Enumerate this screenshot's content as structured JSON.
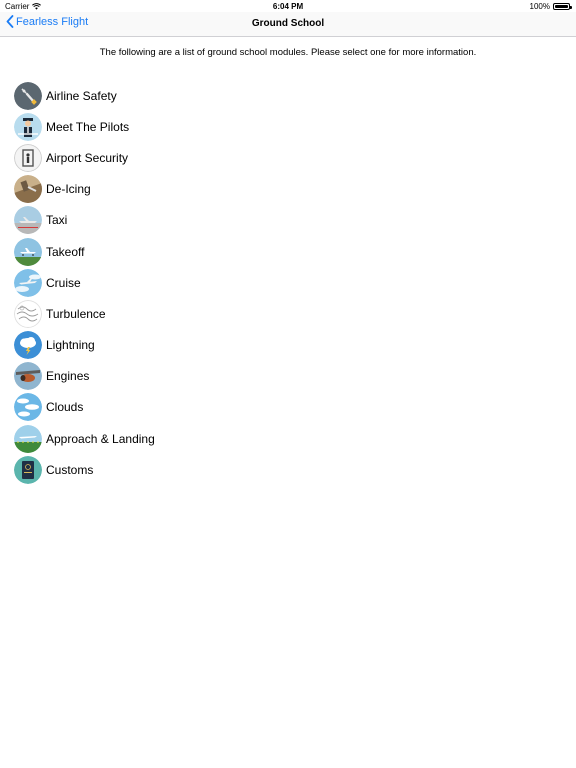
{
  "status_bar": {
    "carrier": "Carrier",
    "time": "6:04 PM",
    "battery": "100%"
  },
  "nav": {
    "back_label": "Fearless Flight",
    "title": "Ground School"
  },
  "intro_text": "The following are a list of ground school modules. Please select one for more information.",
  "colors": {
    "accent": "#1a7cf5"
  },
  "modules": [
    {
      "label": "Airline Safety",
      "icon": "airline-safety-icon"
    },
    {
      "label": "Meet The Pilots",
      "icon": "pilot-icon"
    },
    {
      "label": "Airport Security",
      "icon": "security-gate-icon"
    },
    {
      "label": "De-Icing",
      "icon": "de-icing-icon"
    },
    {
      "label": "Taxi",
      "icon": "taxi-icon"
    },
    {
      "label": "Takeoff",
      "icon": "takeoff-icon"
    },
    {
      "label": "Cruise",
      "icon": "cruise-icon"
    },
    {
      "label": "Turbulence",
      "icon": "turbulence-icon"
    },
    {
      "label": "Lightning",
      "icon": "lightning-icon"
    },
    {
      "label": "Engines",
      "icon": "engine-icon"
    },
    {
      "label": "Clouds",
      "icon": "clouds-icon"
    },
    {
      "label": "Approach & Landing",
      "icon": "landing-icon"
    },
    {
      "label": "Customs",
      "icon": "passport-icon"
    }
  ]
}
